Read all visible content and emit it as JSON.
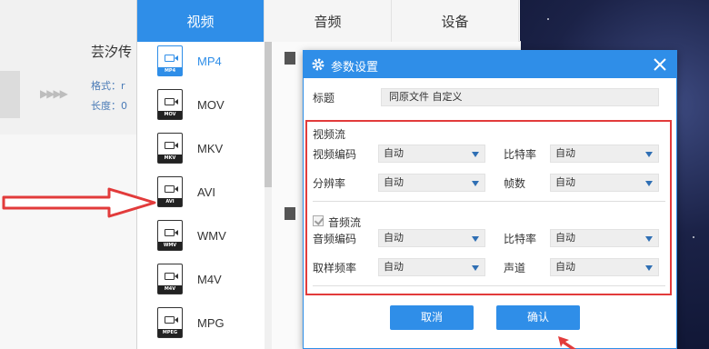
{
  "background_app": {
    "title": "芸汐传",
    "meta_format": "格式：r",
    "meta_length": "长度：0"
  },
  "tabs": [
    {
      "label": "视频"
    },
    {
      "label": "音频"
    },
    {
      "label": "设备"
    }
  ],
  "formats": [
    {
      "label": "MP4",
      "tag": "MP4",
      "active": true
    },
    {
      "label": "MOV",
      "tag": "MOV"
    },
    {
      "label": "MKV",
      "tag": "MKV"
    },
    {
      "label": "AVI",
      "tag": "AVI"
    },
    {
      "label": "WMV",
      "tag": "WMV"
    },
    {
      "label": "M4V",
      "tag": "M4V"
    },
    {
      "label": "MPG",
      "tag": "MPEG"
    }
  ],
  "dialog": {
    "title": "参数设置",
    "name_label": "标题",
    "name_value": "同原文件 自定义",
    "video": {
      "section_label": "视频流",
      "codec_label": "视频编码",
      "codec_value": "自动",
      "bitrate_label": "比特率",
      "bitrate_value": "自动",
      "resolution_label": "分辨率",
      "resolution_value": "自动",
      "framerate_label": "帧数",
      "framerate_value": "自动"
    },
    "audio": {
      "section_label": "音频流",
      "enabled": true,
      "codec_label": "音频编码",
      "codec_value": "自动",
      "bitrate_label": "比特率",
      "bitrate_value": "自动",
      "samplerate_label": "取样频率",
      "samplerate_value": "自动",
      "channel_label": "声道",
      "channel_value": "自动"
    },
    "cancel_label": "取消",
    "confirm_label": "确认"
  },
  "colors": {
    "accent": "#2f8ee8",
    "highlight_red": "#e23b3b"
  }
}
